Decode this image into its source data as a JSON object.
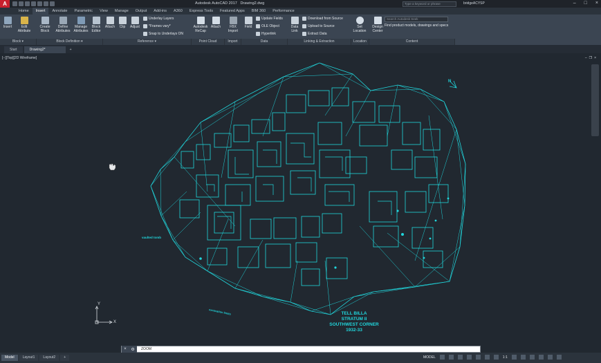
{
  "window": {
    "app_title": "Autodesk AutoCAD 2017",
    "file_title": "Drawing2.dwg",
    "search_placeholder": "Type a keyword or phrase",
    "user": "bridgeACYSP",
    "logo": "A"
  },
  "ribbon_tabs": [
    "Home",
    "Insert",
    "Annotate",
    "Parametric",
    "View",
    "Manage",
    "Output",
    "Add-ins",
    "A360",
    "Express Tools",
    "Featured Apps",
    "BIM 360",
    "Performance"
  ],
  "active_tab": "Insert",
  "ribbon": {
    "insert": "Insert",
    "edit_attribute": "Edit Attribute",
    "create_block": "Create Block",
    "define_attributes": "Define Attributes",
    "manage_attributes": "Manage Attributes",
    "block_editor": "Block Editor",
    "attach": "Attach",
    "clip": "Clip",
    "adjust": "Adjust",
    "underlay_layers": "Underlay Layers",
    "frames_vary": "*Frames vary*",
    "snap_to_underlays": "Snap to Underlays ON",
    "autodesk_recap": "Autodesk ReCap",
    "attach_pc": "Attach",
    "fbx_import": "FBX Import",
    "field": "Field",
    "update_fields": "Update Fields",
    "ole_object": "OLE Object",
    "hyperlink": "Hyperlink",
    "data_link": "Data Link",
    "download_from_source": "Download from Source",
    "upload_to_source": "Upload to Source",
    "extract_data": "Extract  Data",
    "set_location": "Set Location",
    "design_center": "Design Center",
    "content_search_placeholder": "Search Autodesk Seek",
    "content_text": "Find product models, drawings and specs"
  },
  "panels": {
    "block": "Block ▾",
    "block_definition": "Block Definition ▾",
    "reference": "Reference ▾",
    "point_cloud": "Point Cloud",
    "import": "Import",
    "data": "Data",
    "linking": "Linking & Extraction",
    "location": "Location",
    "content": "Content"
  },
  "file_tabs": [
    "Start",
    "Drawing2*"
  ],
  "viewport": {
    "label": "[−][Top][2D Wireframe]"
  },
  "drawing_text": {
    "title_lines": [
      "TELL BILLA",
      "STRATUM II",
      "SOUTHWEST CORNER",
      "1932-33"
    ],
    "north": "N",
    "vaulted_tomb": "vaulted tomb",
    "excavation_limits": "excavation limits",
    "axis_x": "X",
    "axis_y": "Y"
  },
  "command": {
    "text": "ZOOM"
  },
  "status": {
    "tabs": [
      "Model",
      "Layout1",
      "Layout2"
    ],
    "model_label": "MODEL",
    "scale": "1:1"
  },
  "colors": {
    "drawing": "#21d6dc",
    "canvas": "#212830",
    "ribbon": "#3b4552"
  }
}
